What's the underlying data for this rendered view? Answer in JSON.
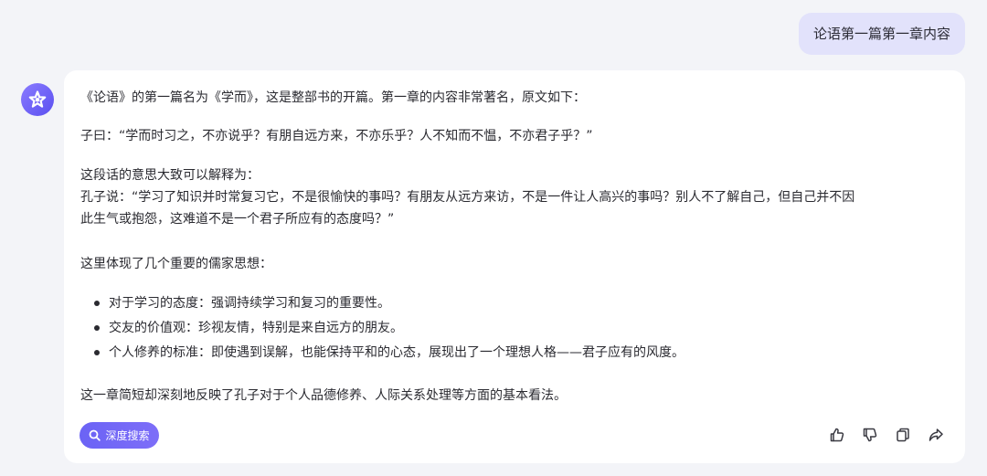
{
  "user_message": "论语第一篇第一章内容",
  "response": {
    "p1": "《论语》的第一篇名为《学而》，这是整部书的开篇。第一章的内容非常著名，原文如下：",
    "p2": "子曰：“学而时习之，不亦说乎？有朋自远方来，不亦乐乎？人不知而不愠，不亦君子乎？”",
    "p3": "这段话的意思大致可以解释为：",
    "p4": "孔子说：“学习了知识并时常复习它，不是很愉快的事吗？有朋友从远方来访，不是一件让人高兴的事吗？别人不了解自己，但自己并不因",
    "p5": "此生气或抱怨，这难道不是一个君子所应有的态度吗？”",
    "p6": "这里体现了几个重要的儒家思想：",
    "bullets": [
      "对于学习的态度：强调持续学习和复习的重要性。",
      "交友的价值观：珍视友情，特别是来自远方的朋友。",
      "个人修养的标准：即使遇到误解，也能保持平和的心态，展现出了一个理想人格——君子应有的风度。"
    ],
    "p7": "这一章简短却深刻地反映了孔子对于个人品德修养、人际关系处理等方面的基本看法。"
  },
  "toolbar": {
    "deep_search_label": "深度搜索"
  },
  "icons": {
    "avatar": "assistant-logo-icon",
    "deep_search": "search-icon",
    "like": "thumbs-up-icon",
    "dislike": "thumbs-down-icon",
    "copy": "copy-icon",
    "share": "share-icon"
  },
  "colors": {
    "accent": "#6b63f5",
    "user_bubble": "#e2e2fb",
    "background": "#f3f4f8"
  }
}
